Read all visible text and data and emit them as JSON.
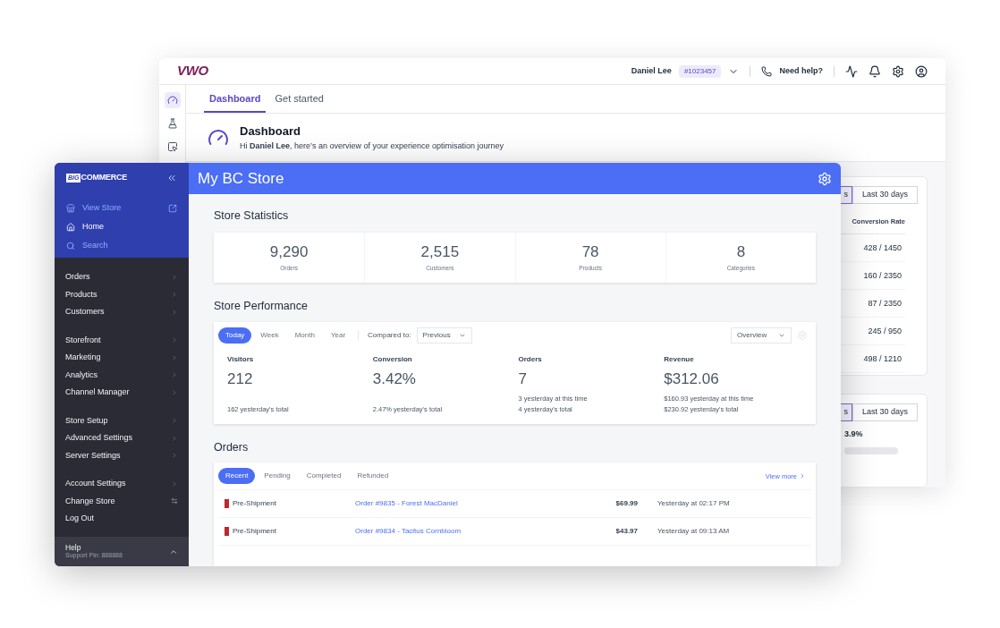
{
  "back_window": {
    "logo": "VWO",
    "header": {
      "user": "Daniel Lee",
      "account_id": "#1023457",
      "help": "Need help?"
    },
    "rail": [
      {
        "selected": true
      },
      {
        "selected": false
      },
      {
        "selected": false
      }
    ],
    "tabs": [
      {
        "label": "Dashboard",
        "selected": true
      },
      {
        "label": "Get started",
        "selected": false
      }
    ],
    "intro": {
      "title": "Dashboard",
      "greeting": "Hi **Daniel Lee**, here’s an overview of your experience optimisation journey"
    },
    "cards": [
      {
        "ranges": [
          {
            "label": "s",
            "selected": true
          },
          {
            "label": "Last 30 days",
            "selected": false
          }
        ],
        "column": "Conversion Rate",
        "rows": [
          "428 / 1450",
          "160 / 2350",
          "87 / 2350",
          "245 / 950",
          "498 / 1210"
        ]
      },
      {
        "ranges": [
          {
            "label": "s",
            "selected": true
          },
          {
            "label": "Last 30 days",
            "selected": false
          }
        ],
        "value": "3.9%"
      }
    ]
  },
  "front_window": {
    "logo": {
      "mark": "BIG",
      "name": "COMMERCE"
    },
    "quick_links": [
      {
        "label": "View Store",
        "selected": false
      },
      {
        "label": "Home",
        "selected": true
      },
      {
        "label": "Search",
        "selected": false
      }
    ],
    "menu_groups": [
      [
        {
          "label": "Orders",
          "kind": "nav"
        },
        {
          "label": "Products",
          "kind": "nav"
        },
        {
          "label": "Customers",
          "kind": "nav"
        }
      ],
      [
        {
          "label": "Storefront",
          "kind": "nav"
        },
        {
          "label": "Marketing",
          "kind": "nav"
        },
        {
          "label": "Analytics",
          "kind": "nav"
        },
        {
          "label": "Channel Manager",
          "kind": "nav"
        }
      ],
      [
        {
          "label": "Store Setup",
          "kind": "nav"
        },
        {
          "label": "Advanced Settings",
          "kind": "nav"
        },
        {
          "label": "Server Settings",
          "kind": "nav"
        }
      ],
      [
        {
          "label": "Account Settings",
          "kind": "nav"
        },
        {
          "label": "Change Store",
          "kind": "switch"
        },
        {
          "label": "Log Out",
          "kind": "plain"
        }
      ]
    ],
    "help": {
      "label": "Help",
      "pin": "Support Pin: 888888"
    },
    "title": "My BC Store",
    "statistics": {
      "title": "Store Statistics",
      "items": [
        {
          "value": "9,290",
          "label": "Orders"
        },
        {
          "value": "2,515",
          "label": "Customers"
        },
        {
          "value": "78",
          "label": "Products"
        },
        {
          "value": "8",
          "label": "Categories"
        }
      ]
    },
    "performance": {
      "title": "Store Performance",
      "periods": [
        {
          "label": "Today",
          "selected": true
        },
        {
          "label": "Week",
          "selected": false
        },
        {
          "label": "Month",
          "selected": false
        },
        {
          "label": "Year",
          "selected": false
        }
      ],
      "compare_label": "Compared to:",
      "compare_value": "Previous",
      "view_value": "Overview",
      "metrics": [
        {
          "label": "Visitors",
          "value": "212",
          "notes": [
            "162 yesterday's total"
          ]
        },
        {
          "label": "Conversion",
          "value": "3.42%",
          "notes": [
            "2.47% yesterday's total"
          ]
        },
        {
          "label": "Orders",
          "value": "7",
          "notes": [
            "3 yesterday at this time",
            "4 yesterday's total"
          ]
        },
        {
          "label": "Revenue",
          "value": "$312.06",
          "notes": [
            "$160.93 yesterday at this time",
            "$230.92 yesterday's total"
          ]
        }
      ]
    },
    "orders": {
      "title": "Orders",
      "tabs": [
        {
          "label": "Recent",
          "selected": true
        },
        {
          "label": "Pending",
          "selected": false
        },
        {
          "label": "Completed",
          "selected": false
        },
        {
          "label": "Refunded",
          "selected": false
        }
      ],
      "view_more": "View more",
      "rows": [
        {
          "status": "Pre-Shipment",
          "color": "#c0262d",
          "order": "Order #9835 - Forest MacDaniel",
          "amount": "$69.99",
          "time": "Yesterday at 02:17 PM"
        },
        {
          "status": "Pre-Shipment",
          "color": "#c0262d",
          "order": "Order #9834 - Tacitus Cornbloom",
          "amount": "$43.97",
          "time": "Yesterday at 09:13 AM"
        }
      ]
    }
  }
}
